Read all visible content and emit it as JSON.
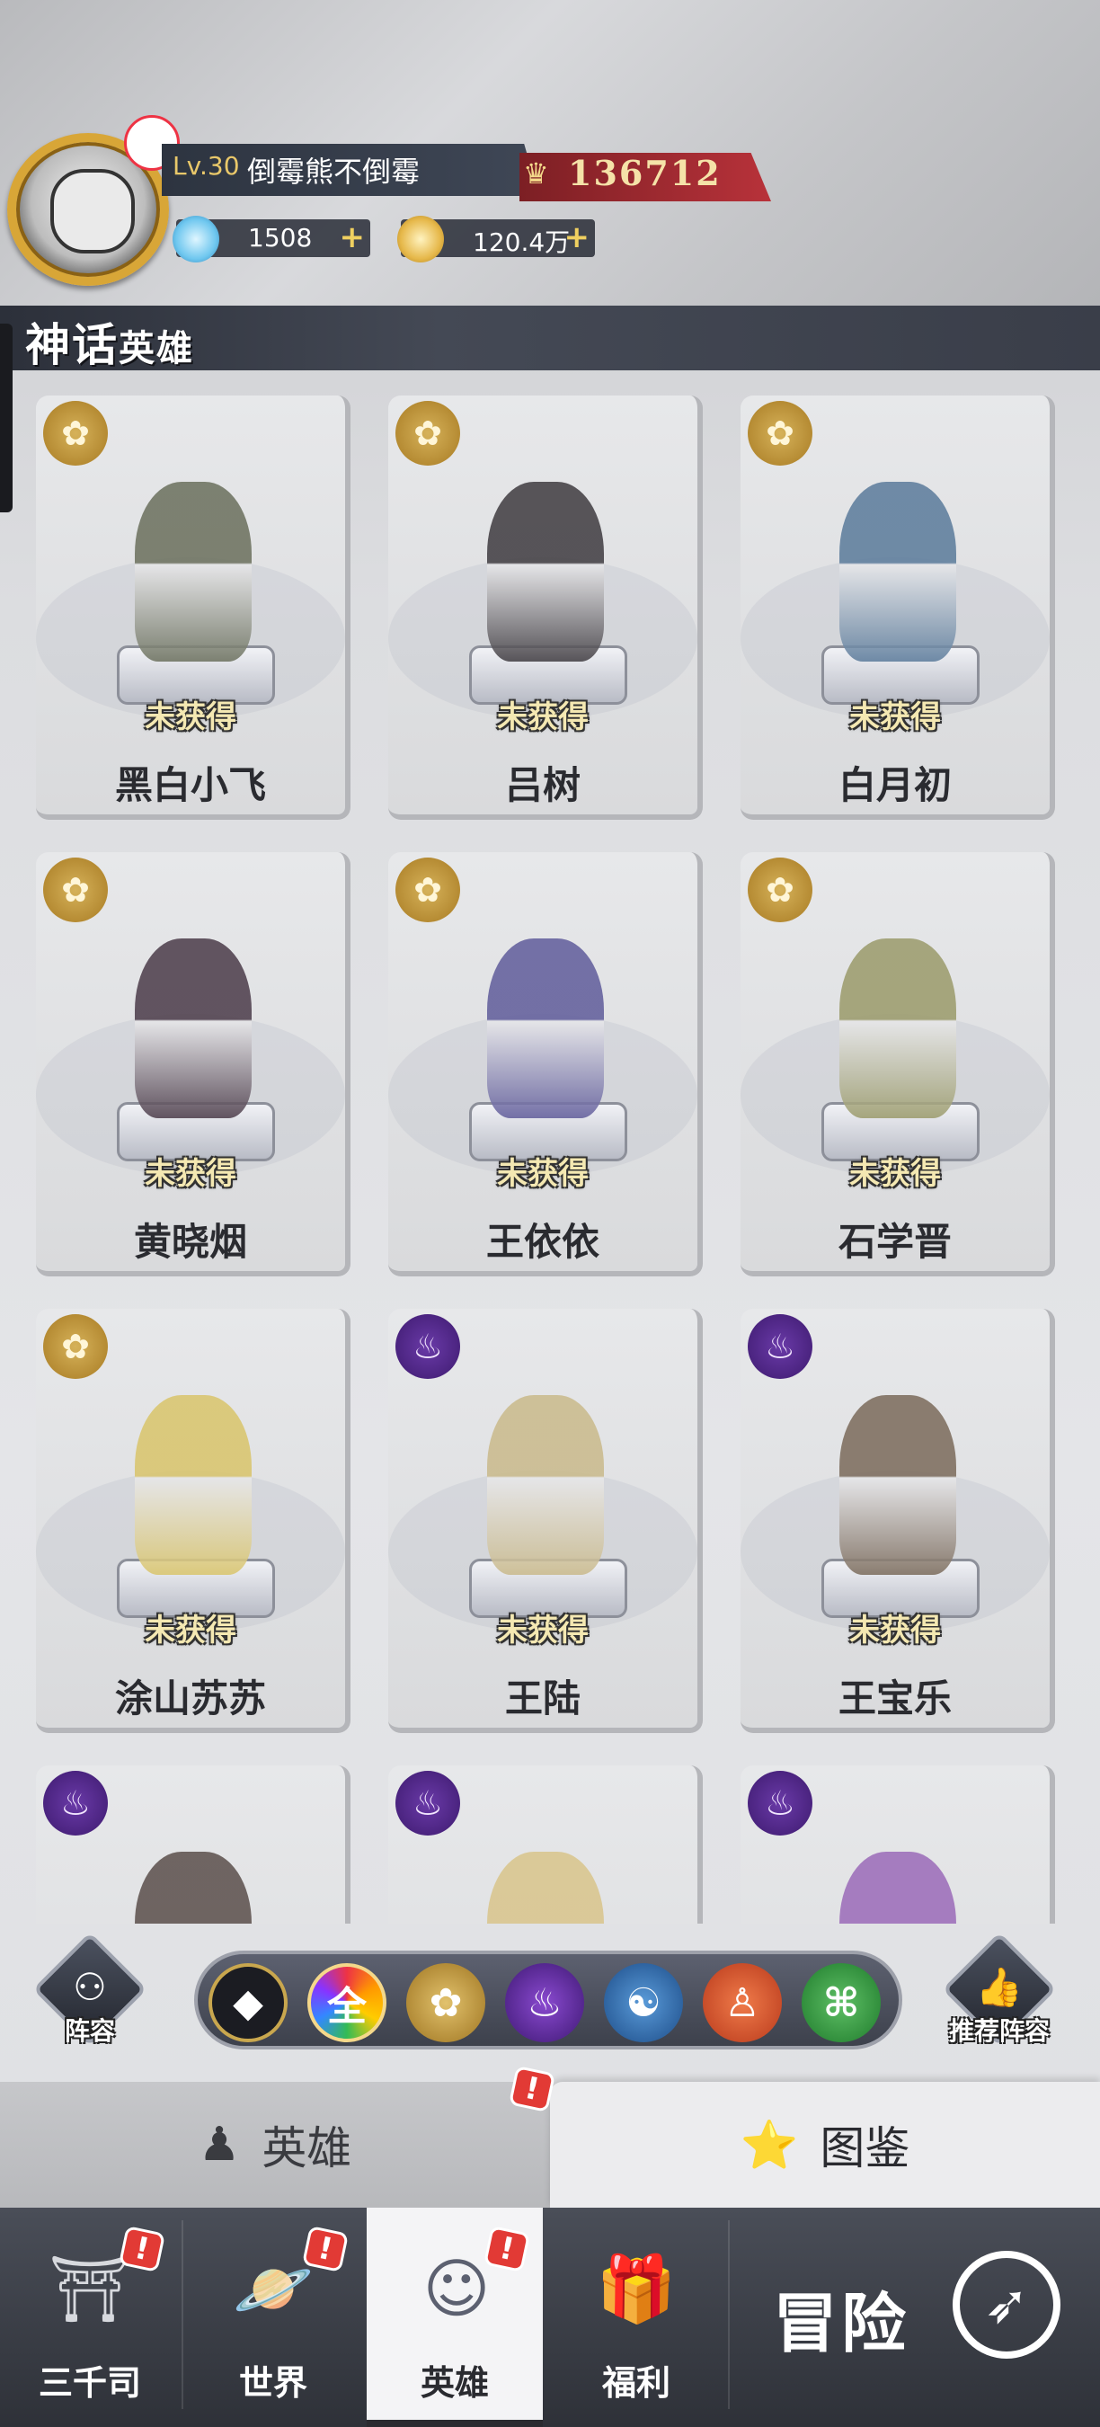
{
  "player": {
    "level": "Lv.30",
    "name": "倒霉熊不倒霉",
    "power": "136712",
    "gems": "1508",
    "gold": "120.4万"
  },
  "section_title_big": "神话",
  "section_title_small": "英雄",
  "heroes": [
    {
      "name": "黑白小飞",
      "status": "未获得",
      "faction": "gold",
      "color": "#6a6f5c"
    },
    {
      "name": "吕树",
      "status": "未获得",
      "faction": "gold",
      "color": "#3e3a3f"
    },
    {
      "name": "白月初",
      "status": "未获得",
      "faction": "gold",
      "color": "#5a7a9a"
    },
    {
      "name": "黄晓烟",
      "status": "未获得",
      "faction": "gold",
      "color": "#4a3a48"
    },
    {
      "name": "王依依",
      "status": "未获得",
      "faction": "gold",
      "color": "#5f5b9a"
    },
    {
      "name": "石学晋",
      "status": "未获得",
      "faction": "gold",
      "color": "#9a9a6a"
    },
    {
      "name": "涂山苏苏",
      "status": "未获得",
      "faction": "gold",
      "color": "#d9c46a"
    },
    {
      "name": "王陆",
      "status": "未获得",
      "faction": "purple",
      "color": "#c9b98a"
    },
    {
      "name": "王宝乐",
      "status": "未获得",
      "faction": "purple",
      "color": "#7a6a5a"
    },
    {
      "name": "",
      "status": "",
      "faction": "purple",
      "color": "#5a4e4a"
    },
    {
      "name": "",
      "status": "",
      "faction": "purple",
      "color": "#d8c48a"
    },
    {
      "name": "",
      "status": "",
      "faction": "purple",
      "color": "#9a6ab8"
    }
  ],
  "faction_icons": {
    "gold": "lotus-icon",
    "purple": "flame-icon"
  },
  "filters": [
    {
      "icon": "diamond-icon",
      "label": "◆"
    },
    {
      "icon": "all-icon",
      "label": "全"
    },
    {
      "icon": "lotus-icon",
      "label": "✿"
    },
    {
      "icon": "flame-icon",
      "label": "♨"
    },
    {
      "icon": "yin-yang-icon",
      "label": "☯"
    },
    {
      "icon": "meditation-icon",
      "label": "♙"
    },
    {
      "icon": "dna-icon",
      "label": "⌘"
    }
  ],
  "side": {
    "lineup": "阵容",
    "recommend": "推荐阵容"
  },
  "subtabs": {
    "hero": "英雄",
    "book": "图鉴"
  },
  "nav": {
    "sanqiansi": "三千司",
    "world": "世界",
    "hero": "英雄",
    "welfare": "福利",
    "adventure": "冒险"
  }
}
